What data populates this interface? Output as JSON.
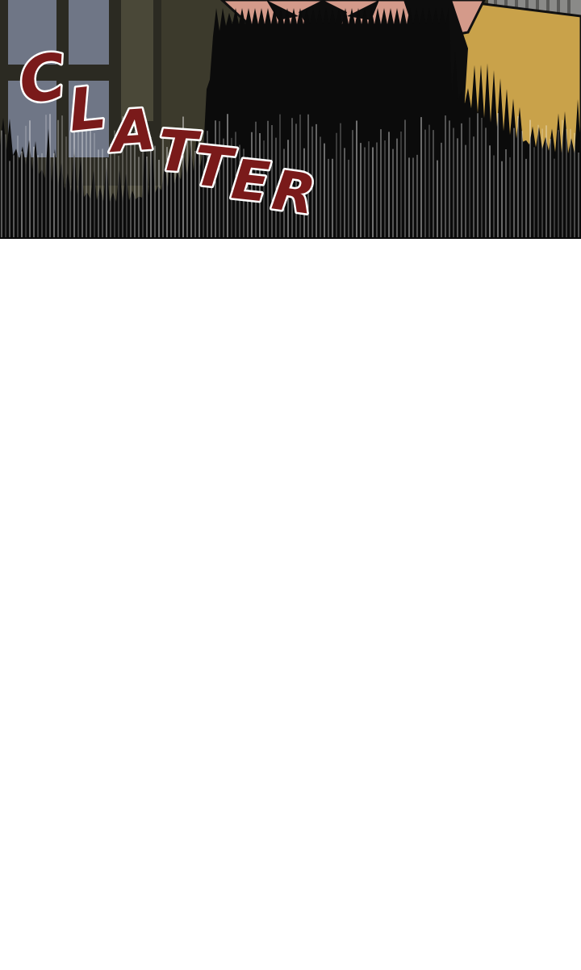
{
  "sound_effect": {
    "text": "CLATTER",
    "letters": [
      "C",
      "L",
      "A",
      "T",
      "T",
      "E",
      "R"
    ],
    "fill_color": "#7a1a1a",
    "outline_color": "#ffffff"
  },
  "scene": {
    "background_wall": "#3c3a2c",
    "window_pane": "#6f7686",
    "robe_yellow": "#c9a24a",
    "robe_blue": "#2f3f63",
    "skin": "#d49a8a",
    "hair": "#0d0d0d"
  }
}
